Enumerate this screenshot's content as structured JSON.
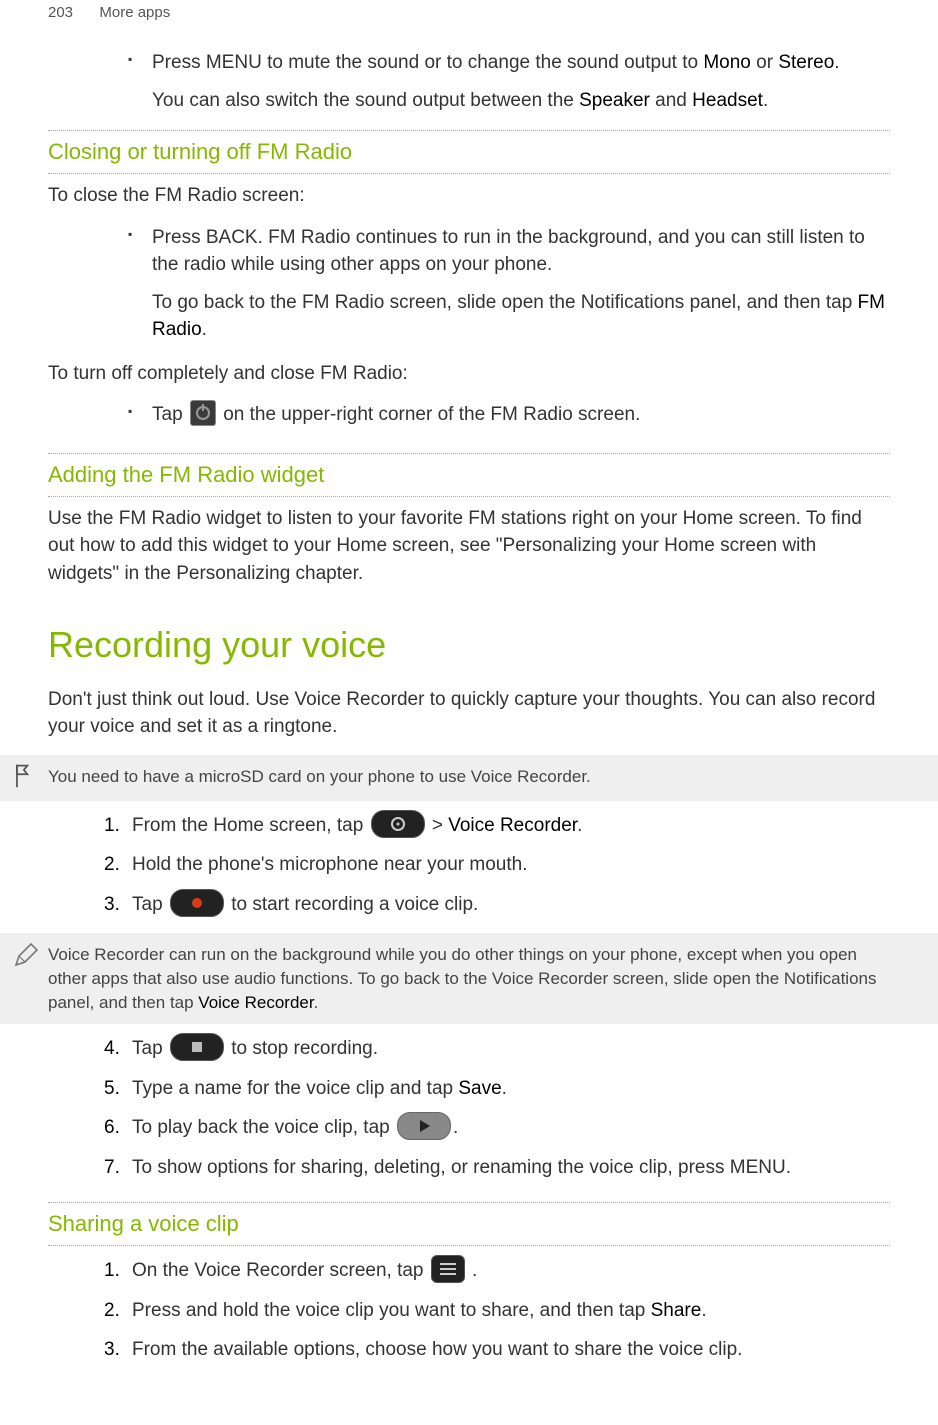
{
  "header": {
    "page_number": "203",
    "section": "More apps"
  },
  "s1": {
    "bullet1a": "Press MENU to mute the sound or to change the sound output to ",
    "bullet1b": "Mono",
    "bullet1c": " or ",
    "bullet1d": "Stereo",
    "bullet1e": ".",
    "follow1a": "You can also switch the sound output between the ",
    "follow1b": "Speaker",
    "follow1c": " and ",
    "follow1d": "Headset",
    "follow1e": "."
  },
  "closing": {
    "title": "Closing or turning off FM Radio",
    "intro": "To close the FM Radio screen:",
    "b1": "Press BACK. FM Radio continues to run in the background, and you can still listen to the radio while using other apps on your phone.",
    "b1fa": "To go back to the FM Radio screen, slide open the Notifications panel, and then tap ",
    "b1fb": "FM Radio",
    "b1fc": ".",
    "intro2": "To turn off completely and close FM Radio:",
    "b2a": "Tap ",
    "b2b": " on the upper-right corner of the FM Radio screen."
  },
  "widget": {
    "title": "Adding the FM Radio widget",
    "body": "Use the FM Radio widget to listen to your favorite FM stations right on your Home screen. To find out how to add this widget to your Home screen, see \"Personalizing your Home screen with widgets\" in the Personalizing chapter."
  },
  "recording": {
    "title": "Recording your voice",
    "intro": "Don't just think out loud. Use Voice Recorder to quickly capture your thoughts. You can also record your voice and set it as a ringtone.",
    "note1": "You need to have a microSD card on your phone to use Voice Recorder.",
    "step1a": "From the Home screen, tap ",
    "step1b": " > ",
    "step1c": "Voice Recorder",
    "step1d": ".",
    "step2": "Hold the phone's microphone near your mouth.",
    "step3a": "Tap ",
    "step3b": " to start recording a voice clip.",
    "note2a": "Voice Recorder can run on the background while you do other things on your phone, except when you open other apps that also use audio functions. To go back to the Voice Recorder screen, slide open the Notifications panel, and then tap ",
    "note2b": "Voice Recorder",
    "note2c": ".",
    "step4a": "Tap ",
    "step4b": " to stop recording.",
    "step5a": "Type a name for the voice clip and tap ",
    "step5b": "Save",
    "step5c": ".",
    "step6a": "To play back the voice clip, tap ",
    "step6b": ".",
    "step7": "To show options for sharing, deleting, or renaming the voice clip, press MENU."
  },
  "sharing": {
    "title": "Sharing a voice clip",
    "s1a": "On the Voice Recorder screen, tap ",
    "s1b": " .",
    "s2a": "Press and hold the voice clip you want to share, and then tap ",
    "s2b": "Share",
    "s2c": ".",
    "s3": "From the available options, choose how you want to share the voice clip."
  }
}
